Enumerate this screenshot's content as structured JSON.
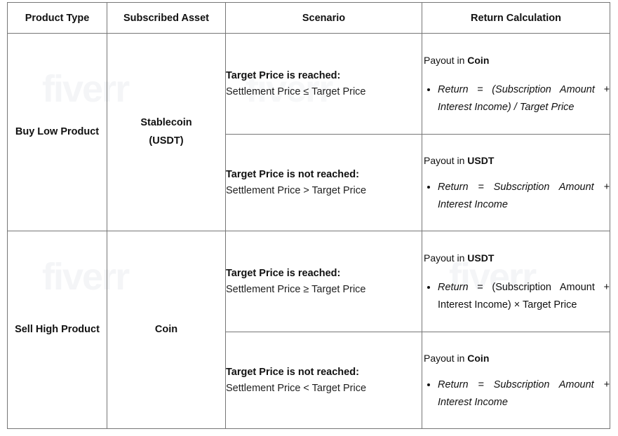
{
  "watermarks": [
    "fiverr",
    "fiverr",
    "fiverr",
    "fiverr"
  ],
  "table": {
    "headers": [
      {
        "label": "Product Type"
      },
      {
        "label": "Subscribed Asset"
      },
      {
        "label": "Scenario"
      },
      {
        "label": "Return Calculation"
      }
    ],
    "products": [
      {
        "product_type": "Buy Low Product",
        "asset_line1": "Stablecoin",
        "asset_line2": "(USDT)",
        "rows": [
          {
            "scenario_title": "Target Price is reached:",
            "scenario_sub": "Settlement Price ≤ Target Price",
            "payout_prefix": "Payout in ",
            "payout_asset": "Coin",
            "formula_style": "all-italic",
            "formula_term": "Return",
            "formula_rest": " = (Subscription Amount + Interest Income) / Target Price",
            "formula_full": "Return = (Subscription Amount + Interest Income) / Target Price"
          },
          {
            "scenario_title": "Target Price is not reached:",
            "scenario_sub": "Settlement Price > Target Price",
            "payout_prefix": "Payout in ",
            "payout_asset": "USDT",
            "formula_style": "all-italic",
            "formula_term": "Return",
            "formula_rest": " = Subscription Amount + Interest Income",
            "formula_full": "Return = Subscription Amount + Interest Income"
          }
        ]
      },
      {
        "product_type_line1": "Sell High",
        "product_type_line2": "Product",
        "asset_line1": "Coin",
        "asset_line2": "",
        "rows": [
          {
            "scenario_title": "Target Price is reached:",
            "scenario_sub": "Settlement Price ≥ Target Price",
            "payout_prefix": "Payout in ",
            "payout_asset": "USDT",
            "formula_style": "part-italic",
            "formula_term": "Return",
            "formula_rest": " = (Subscription Amount + Interest Income) × Target Price",
            "formula_full": "Return = (Subscription Amount + Interest Income) × Target Price"
          },
          {
            "scenario_title": "Target Price is not reached:",
            "scenario_sub": "Settlement Price < Target Price",
            "payout_prefix": "Payout in ",
            "payout_asset": "Coin",
            "formula_style": "all-italic",
            "formula_term": "Return",
            "formula_rest": " = Subscription Amount + Interest Income",
            "formula_full": "Return = Subscription Amount + Interest Income"
          }
        ]
      }
    ]
  },
  "colors": {
    "border": "#767676",
    "text": "#111111",
    "background": "#ffffff",
    "watermark": "#f4f5f7"
  }
}
